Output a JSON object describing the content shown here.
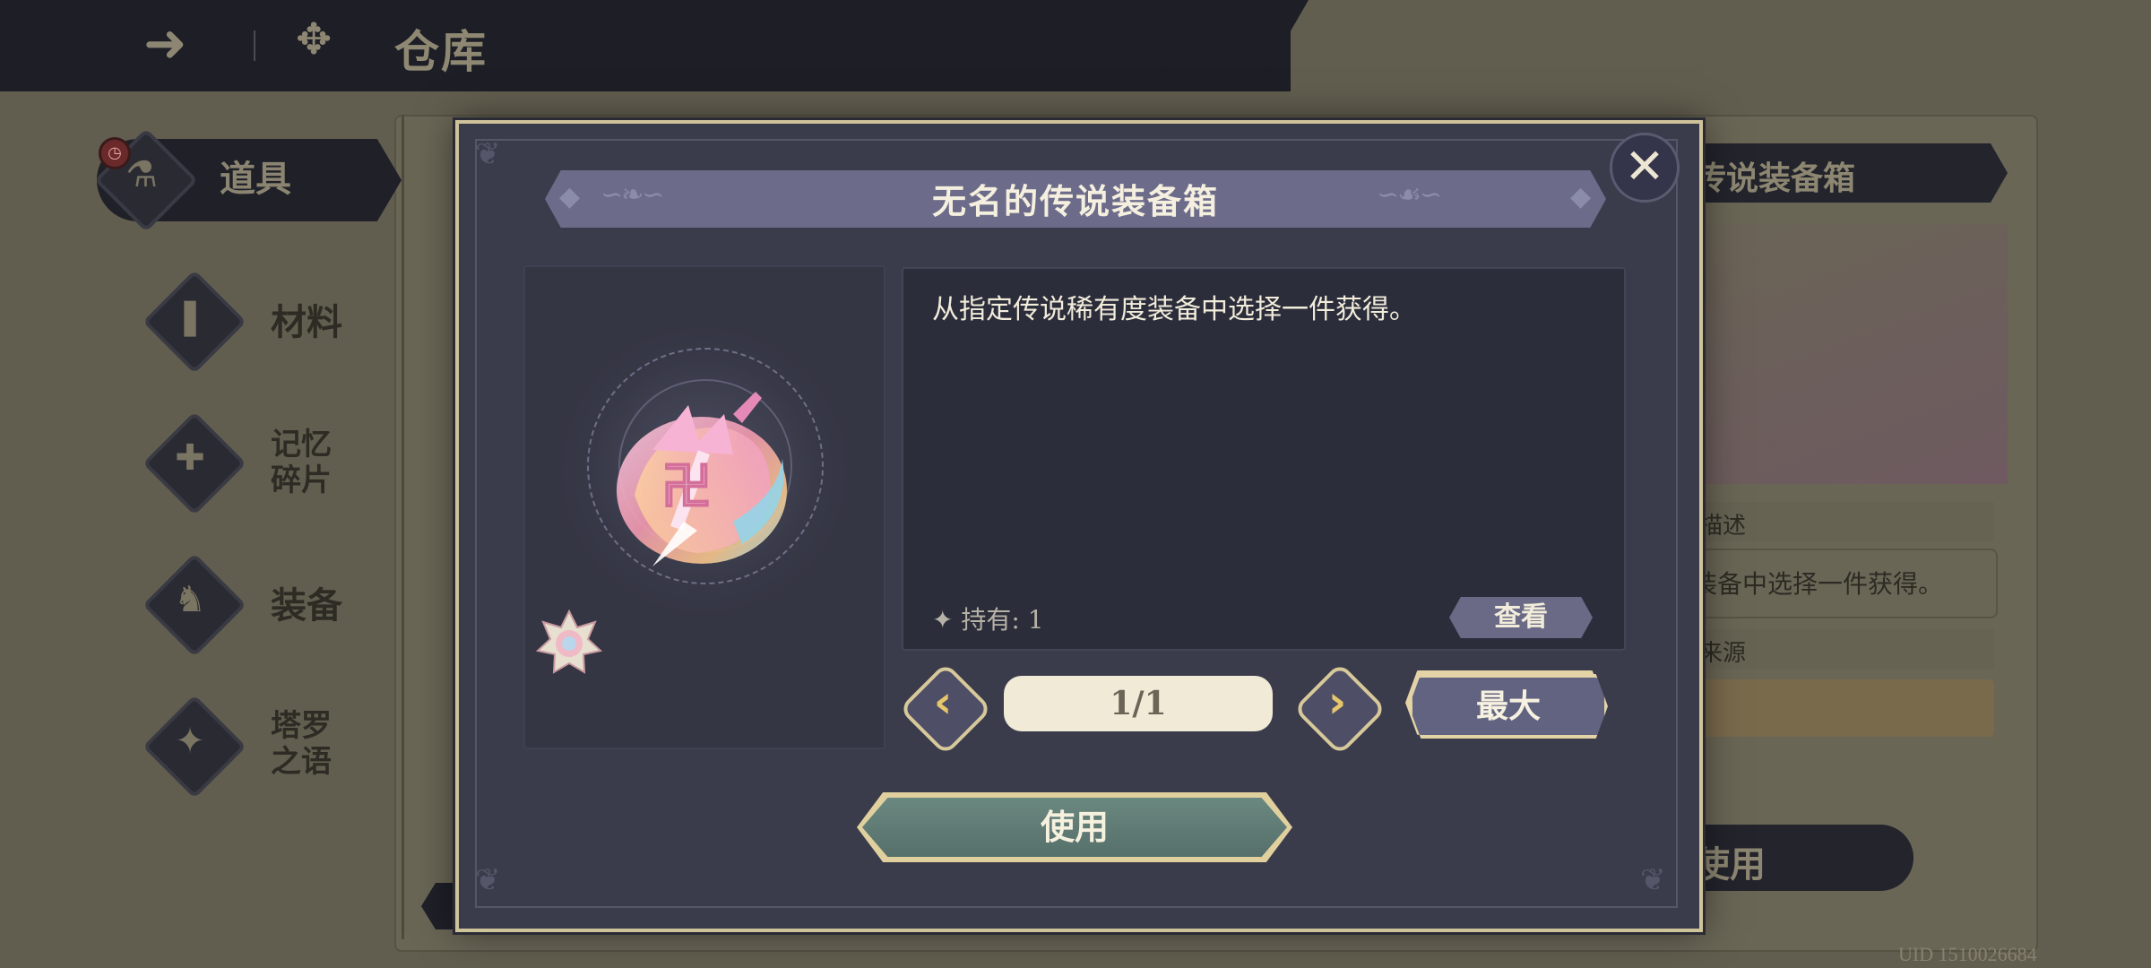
{
  "header": {
    "title": "仓库"
  },
  "sidebar": {
    "items": [
      {
        "label": "道具"
      },
      {
        "label": "材料"
      },
      {
        "label": "记忆\n碎片"
      },
      {
        "label": "装备"
      },
      {
        "label": "塔罗\n之语"
      }
    ]
  },
  "background_panel": {
    "item_title": "传说装备箱",
    "desc_label": "描述",
    "desc_text": "装备中选择一件获得。",
    "source_label": "来源",
    "use_label": "使用"
  },
  "uid": "UID 1510026684",
  "modal": {
    "title": "无名的传说装备箱",
    "description": "从指定传说稀有度装备中选择一件获得。",
    "held": "✦ 持有: 1",
    "view_label": "查看",
    "quantity": "1/1",
    "max_label": "最大",
    "use_label": "使用",
    "close_icon": "close-icon"
  },
  "colors": {
    "modal_bg": "#3b3c4b",
    "gold_border": "#cfc39a",
    "use_button": "#5f7c76",
    "banner": "#6c6c8a"
  }
}
